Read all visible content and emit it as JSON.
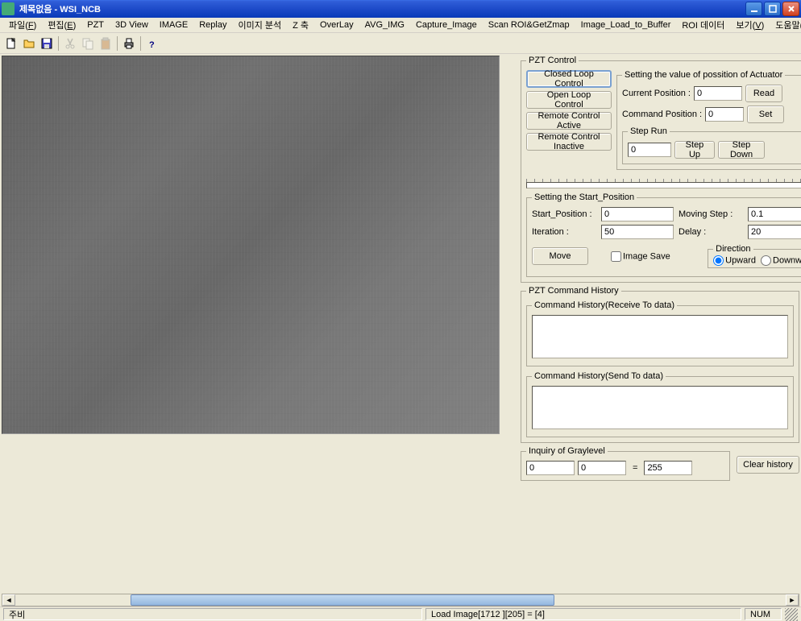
{
  "titlebar": {
    "title": "제목없음 - WSI_NCB"
  },
  "menu": {
    "items": [
      {
        "label": "파일(F)",
        "key": "F"
      },
      {
        "label": "편집(E)",
        "key": "E"
      },
      {
        "label": "PZT",
        "key": ""
      },
      {
        "label": "3D View",
        "key": ""
      },
      {
        "label": "IMAGE",
        "key": ""
      },
      {
        "label": "Replay",
        "key": ""
      },
      {
        "label": "이미지 분석",
        "key": ""
      },
      {
        "label": "Z 축",
        "key": ""
      },
      {
        "label": "OverLay",
        "key": ""
      },
      {
        "label": "AVG_IMG",
        "key": ""
      },
      {
        "label": "Capture_Image",
        "key": ""
      },
      {
        "label": "Scan ROI&GetZmap",
        "key": ""
      },
      {
        "label": "Image_Load_to_Buffer",
        "key": ""
      },
      {
        "label": "ROI 데이터",
        "key": ""
      },
      {
        "label": "보기(V)",
        "key": "V"
      },
      {
        "label": "도움말(H)",
        "key": "H"
      }
    ]
  },
  "pzt": {
    "legend": "PZT Control",
    "closed_loop": "Closed Loop Control",
    "open_loop": "Open Loop Control",
    "remote_active": "Remote Control Active",
    "remote_inactive": "Remote Control Inactive",
    "actuator_legend": "Setting the value of possition of Actuator",
    "current_pos_label": "Current Position :",
    "current_pos": "0",
    "read": "Read",
    "command_pos_label": "Command Position :",
    "command_pos": "0",
    "set": "Set",
    "step_run_legend": "Step Run",
    "step_run_value": "0",
    "step_up": "Step Up",
    "step_down": "Step Down"
  },
  "start_pos": {
    "legend": "Setting the Start_Position",
    "start_label": "Start_Position :",
    "start_value": "0",
    "moving_label": "Moving Step :",
    "moving_value": "0.1",
    "iter_label": "Iteration :",
    "iter_value": "50",
    "delay_label": "Delay :",
    "delay_value": "20",
    "move": "Move",
    "image_save": "Image Save",
    "direction_legend": "Direction",
    "upward": "Upward",
    "downward": "Downward"
  },
  "history": {
    "legend": "PZT Command History",
    "receive_legend": "Command History(Receive To data)",
    "send_legend": "Command History(Send To data)",
    "receive": "",
    "send": ""
  },
  "graylevel": {
    "legend": "Inquiry of Graylevel",
    "v1": "0",
    "v2": "0",
    "v3": "255"
  },
  "clear_history": "Clear history",
  "status": {
    "left": "주비",
    "center": "Load Image[1712 ][205] = [4]",
    "right": "NUM"
  }
}
